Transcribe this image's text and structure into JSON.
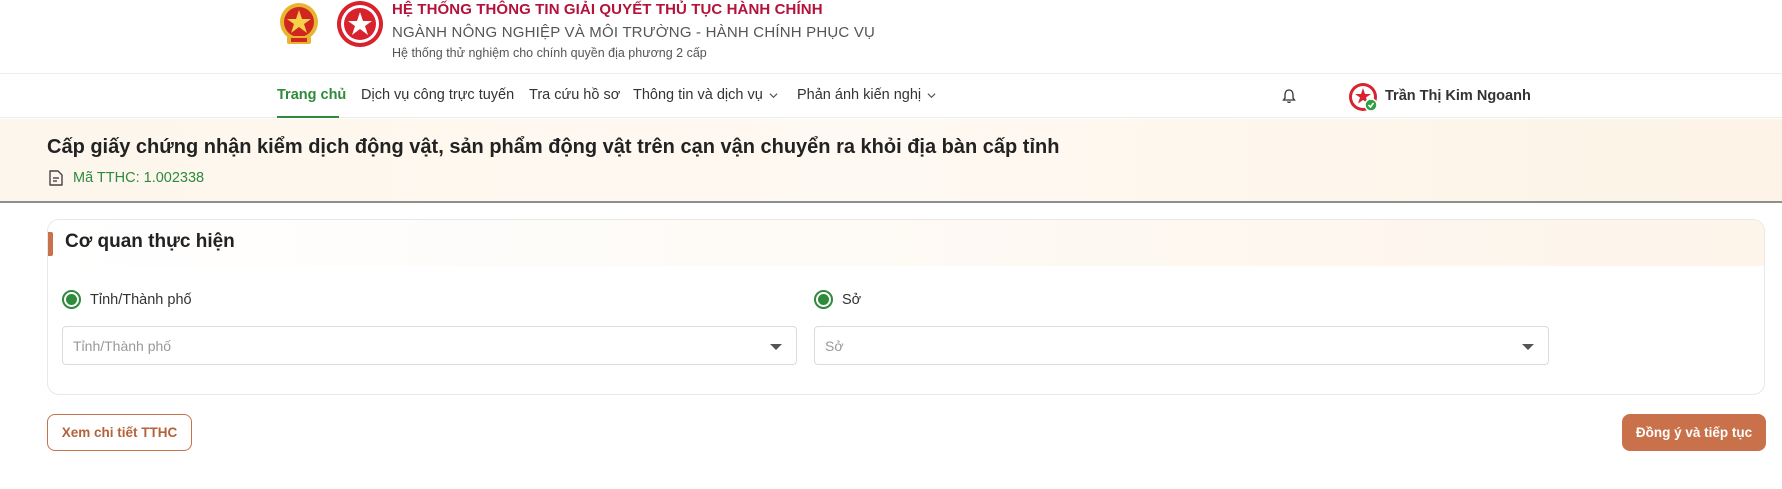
{
  "header": {
    "title": "HỆ THỐNG THÔNG TIN GIẢI QUYẾT THỦ TỤC HÀNH CHÍNH",
    "subtitle": "NGÀNH NÔNG NGHIỆP VÀ MÔI TRƯỜNG - HÀNH CHÍNH PHỤC VỤ",
    "note": "Hệ thống thử nghiệm cho chính quyền địa phương 2 cấp"
  },
  "nav": {
    "items": [
      {
        "label": "Trang chủ",
        "active": true
      },
      {
        "label": "Dịch vụ công trực tuyến"
      },
      {
        "label": "Tra cứu hồ sơ"
      },
      {
        "label": "Thông tin và dịch vụ",
        "dropdown": true
      },
      {
        "label": "Phản ánh kiến nghị",
        "dropdown": true
      }
    ],
    "user_name": "Trần Thị Kim Ngoanh"
  },
  "procedure": {
    "title": "Cấp giấy chứng nhận kiểm dịch động vật, sản phẩm động vật trên cạn vận chuyển ra khỏi địa bàn cấp tỉnh",
    "code": "Mã TTHC: 1.002338"
  },
  "agency": {
    "title": "Cơ quan thực hiện",
    "options": [
      {
        "radio_label": "Tỉnh/Thành phố",
        "selected": true,
        "placeholder": "Tỉnh/Thành phố"
      },
      {
        "radio_label": "Sở",
        "selected": true,
        "placeholder": "Sở"
      }
    ]
  },
  "actions": {
    "detail_label": "Xem chi tiết TTHC",
    "continue_label": "Đồng ý và tiếp tục"
  },
  "colors": {
    "brand_red": "#b3123a",
    "green": "#2f8a3c",
    "accent": "#c9714a"
  }
}
